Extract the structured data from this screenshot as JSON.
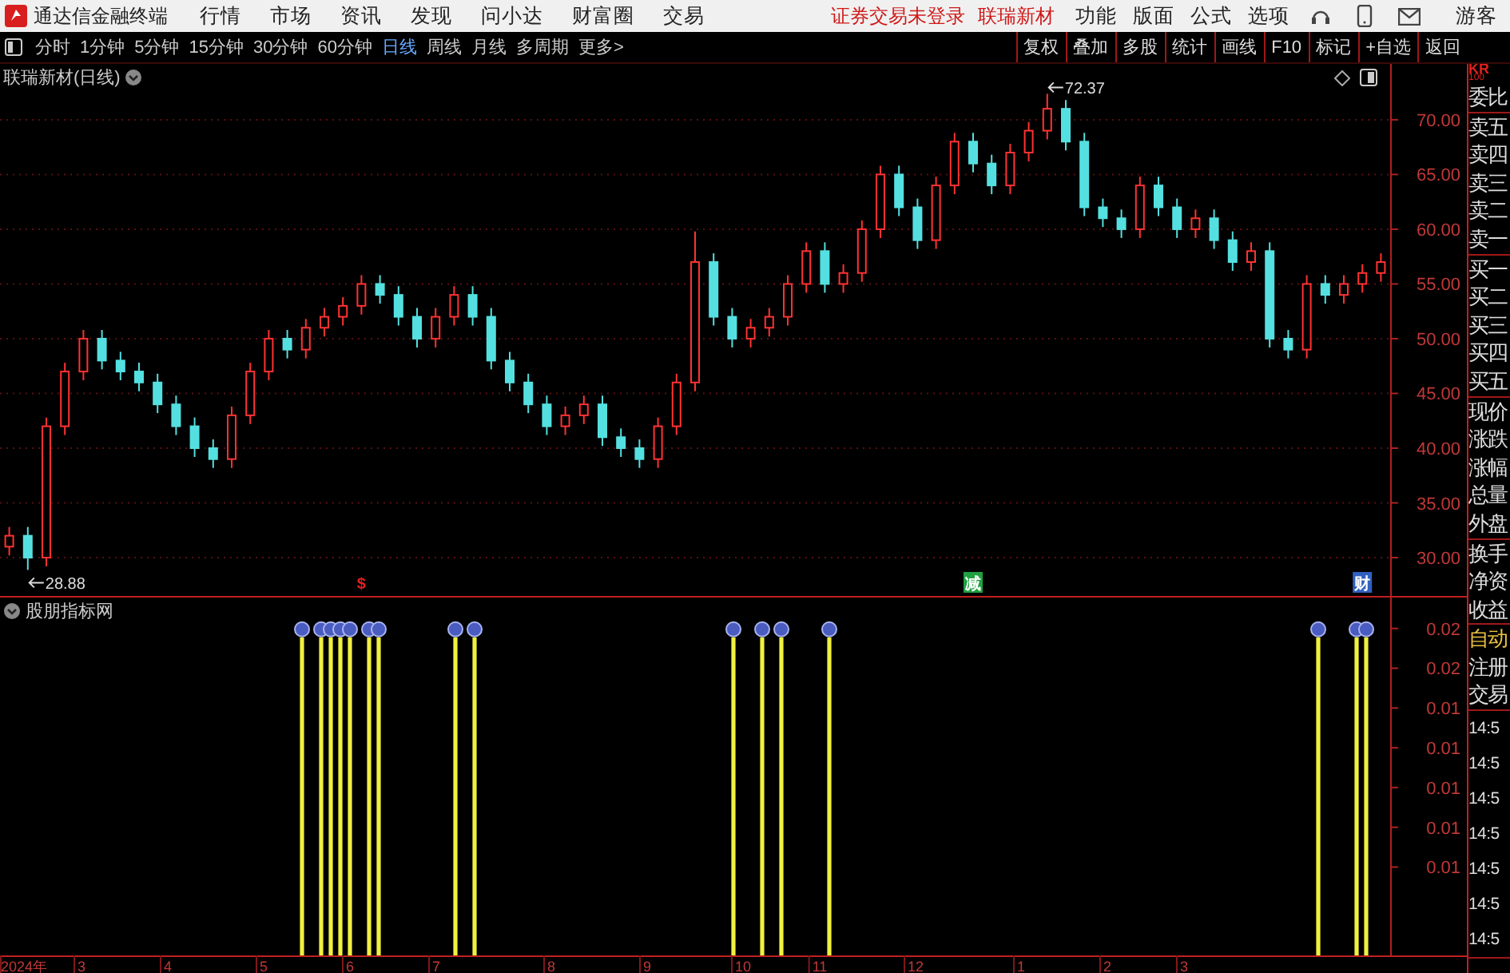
{
  "title_bar": {
    "app_title": "通达信金融终端",
    "menu": [
      "行情",
      "市场",
      "资讯",
      "发现",
      "问小达",
      "财富圈",
      "交易"
    ],
    "notices": [
      "证券交易未登录",
      "联瑞新材"
    ],
    "tools": [
      "功能",
      "版面",
      "公式",
      "选项"
    ],
    "user": "游客"
  },
  "toolbar": {
    "periods": [
      {
        "label": "分时",
        "selected": false
      },
      {
        "label": "1分钟",
        "selected": false
      },
      {
        "label": "5分钟",
        "selected": false
      },
      {
        "label": "15分钟",
        "selected": false
      },
      {
        "label": "30分钟",
        "selected": false
      },
      {
        "label": "60分钟",
        "selected": false
      },
      {
        "label": "日线",
        "selected": true
      },
      {
        "label": "周线",
        "selected": false
      },
      {
        "label": "月线",
        "selected": false
      },
      {
        "label": "多周期",
        "selected": false
      },
      {
        "label": "更多>",
        "selected": false
      }
    ],
    "buttons": [
      "复权",
      "叠加",
      "多股",
      "统计",
      "画线",
      "F10",
      "标记",
      "+自选",
      "返回"
    ]
  },
  "price_pane": {
    "title": "联瑞新材(日线)",
    "chart_data": {
      "type": "candlestick",
      "grid": true,
      "ylim": [
        26.5,
        75.1
      ],
      "categories": [
        null,
        null,
        null,
        null,
        null,
        null,
        null,
        null,
        null,
        null,
        null,
        null,
        null,
        null,
        null,
        null,
        null,
        null,
        null,
        null,
        null,
        null,
        null,
        null,
        null,
        null,
        null,
        null,
        null,
        null,
        null,
        null,
        null,
        null,
        null,
        null,
        null,
        null,
        null,
        null,
        null,
        null,
        null,
        null,
        null,
        null,
        null,
        null,
        null,
        null,
        null,
        null,
        null,
        null,
        null,
        null,
        null,
        null,
        null,
        null,
        null,
        null,
        null,
        null,
        null,
        null,
        null,
        null,
        null,
        null,
        null,
        null,
        null,
        null,
        null
      ],
      "yticks": [
        {
          "value": 30,
          "label": "30.00"
        },
        {
          "value": 35,
          "label": "35.00"
        },
        {
          "value": 40,
          "label": "40.00"
        },
        {
          "value": 45,
          "label": "45.00"
        },
        {
          "value": 50,
          "label": "50.00"
        },
        {
          "value": 55,
          "label": "55.00"
        },
        {
          "value": 60,
          "label": "60.00"
        },
        {
          "value": 65,
          "label": "65.00"
        },
        {
          "value": 70,
          "label": "70.00"
        }
      ],
      "ohlc": [
        [
          31,
          32.8,
          30.2,
          32
        ],
        [
          32,
          32.8,
          28.88,
          30
        ],
        [
          30,
          42.8,
          29.2,
          42
        ],
        [
          42,
          47.8,
          41.2,
          47
        ],
        [
          47,
          50.8,
          46.2,
          50
        ],
        [
          50,
          50.8,
          47.2,
          48
        ],
        [
          48,
          48.8,
          46.2,
          47
        ],
        [
          47,
          47.8,
          45.2,
          46
        ],
        [
          46,
          46.8,
          43.2,
          44
        ],
        [
          44,
          44.8,
          41.2,
          42
        ],
        [
          42,
          42.8,
          39.2,
          40
        ],
        [
          40,
          40.8,
          38.2,
          39
        ],
        [
          39,
          43.8,
          38.2,
          43
        ],
        [
          43,
          47.8,
          42.2,
          47
        ],
        [
          47,
          50.8,
          46.2,
          50
        ],
        [
          50,
          50.8,
          48.2,
          49
        ],
        [
          49,
          51.8,
          48.2,
          51
        ],
        [
          51,
          52.8,
          50.2,
          52
        ],
        [
          52,
          53.8,
          51.2,
          53
        ],
        [
          53,
          55.8,
          52.2,
          55
        ],
        [
          55,
          55.8,
          53.2,
          54
        ],
        [
          54,
          54.8,
          51.2,
          52
        ],
        [
          52,
          52.8,
          49.2,
          50
        ],
        [
          50,
          52.8,
          49.2,
          52
        ],
        [
          52,
          54.8,
          51.2,
          54
        ],
        [
          54,
          54.8,
          51.2,
          52
        ],
        [
          52,
          52.8,
          47.2,
          48
        ],
        [
          48,
          48.8,
          45.2,
          46
        ],
        [
          46,
          46.8,
          43.2,
          44
        ],
        [
          44,
          44.8,
          41.2,
          42
        ],
        [
          42,
          43.8,
          41.2,
          43
        ],
        [
          43,
          44.8,
          42.2,
          44
        ],
        [
          44,
          44.8,
          40.2,
          41
        ],
        [
          41,
          41.8,
          39.2,
          40
        ],
        [
          40,
          40.8,
          38.2,
          39
        ],
        [
          39,
          42.8,
          38.2,
          42
        ],
        [
          42,
          46.8,
          41.2,
          46
        ],
        [
          46,
          59.8,
          45.2,
          57
        ],
        [
          57,
          57.8,
          51.2,
          52
        ],
        [
          52,
          52.8,
          49.2,
          50
        ],
        [
          50,
          51.8,
          49.2,
          51
        ],
        [
          51,
          52.8,
          50.2,
          52
        ],
        [
          52,
          55.8,
          51.2,
          55
        ],
        [
          55,
          58.8,
          54.2,
          58
        ],
        [
          58,
          58.8,
          54.2,
          55
        ],
        [
          55,
          56.8,
          54.2,
          56
        ],
        [
          56,
          60.8,
          55.2,
          60
        ],
        [
          60,
          65.8,
          59.2,
          65
        ],
        [
          65,
          65.8,
          61.2,
          62
        ],
        [
          62,
          62.8,
          58.2,
          59
        ],
        [
          59,
          64.8,
          58.2,
          64
        ],
        [
          64,
          68.8,
          63.2,
          68
        ],
        [
          68,
          68.8,
          65.2,
          66
        ],
        [
          66,
          66.8,
          63.2,
          64
        ],
        [
          64,
          67.8,
          63.2,
          67
        ],
        [
          67,
          69.8,
          66.2,
          69
        ],
        [
          69,
          72.37,
          68.2,
          71
        ],
        [
          71,
          71.8,
          67.2,
          68
        ],
        [
          68,
          68.8,
          61.2,
          62
        ],
        [
          62,
          62.8,
          60.2,
          61
        ],
        [
          61,
          61.8,
          59.2,
          60
        ],
        [
          60,
          64.8,
          59.2,
          64
        ],
        [
          64,
          64.8,
          61.2,
          62
        ],
        [
          62,
          62.8,
          59.2,
          60
        ],
        [
          60,
          61.8,
          59.2,
          61
        ],
        [
          61,
          61.8,
          58.2,
          59
        ],
        [
          59,
          59.8,
          56.2,
          57
        ],
        [
          57,
          58.8,
          56.2,
          58
        ],
        [
          58,
          58.8,
          49.2,
          50
        ],
        [
          50,
          50.8,
          48.2,
          49
        ],
        [
          49,
          55.8,
          48.2,
          55
        ],
        [
          55,
          55.8,
          53.2,
          54
        ],
        [
          54,
          55.8,
          53.2,
          55
        ],
        [
          55,
          56.8,
          54.2,
          56
        ],
        [
          56,
          57.8,
          55.2,
          57
        ]
      ],
      "annotations": [
        "72.37",
        "28.88"
      ]
    },
    "events": [
      {
        "text": "$",
        "color": "#e02020"
      },
      {
        "text": "减",
        "color": "#20a040"
      },
      {
        "text": "财",
        "color": "#3060c0"
      }
    ]
  },
  "indicator_pane": {
    "title": "股朋指标网",
    "chart_data": {
      "type": "bar",
      "ylim": [
        0.0037,
        0.0199
      ],
      "categories": [
        null,
        null,
        "2024年",
        null,
        null,
        null,
        null,
        null,
        "3",
        null,
        null,
        null,
        null,
        null,
        null,
        null,
        null,
        "4",
        null,
        null,
        null,
        null,
        null,
        null,
        null,
        null,
        null,
        "5",
        null,
        null,
        null,
        null,
        null,
        null,
        null,
        null,
        "6",
        null,
        null,
        null,
        null,
        null,
        null,
        null,
        null,
        "7",
        null,
        null,
        null,
        null,
        null,
        null,
        null,
        null,
        null,
        null,
        null,
        "8",
        null,
        null,
        null,
        null,
        null,
        null,
        null,
        null,
        null,
        "9",
        null,
        null,
        null,
        null,
        null,
        null,
        null,
        null,
        null,
        "10",
        null,
        null,
        null,
        null,
        null,
        null,
        null,
        "11",
        null,
        null,
        null,
        null,
        null,
        null,
        null,
        null,
        null,
        "12",
        null,
        null,
        null,
        null,
        null,
        null,
        null,
        null,
        null,
        null,
        "1",
        null,
        null,
        null,
        null,
        null,
        null,
        null,
        null,
        "2",
        null,
        null,
        null,
        null,
        null,
        null,
        null,
        "3",
        null,
        null,
        null,
        null,
        null,
        null,
        null,
        null,
        null,
        null,
        null,
        null,
        null,
        null,
        null,
        null,
        null,
        null,
        null,
        null,
        null
      ],
      "values": [
        null,
        null,
        null,
        null,
        null,
        null,
        null,
        null,
        null,
        null,
        null,
        null,
        null,
        null,
        null,
        null,
        null,
        null,
        null,
        null,
        null,
        null,
        null,
        null,
        null,
        null,
        null,
        null,
        null,
        null,
        null,
        0.0181,
        null,
        0.0181,
        0.0181,
        0.0181,
        0.0181,
        null,
        0.0181,
        0.0181,
        null,
        null,
        null,
        null,
        null,
        null,
        null,
        0.0181,
        null,
        0.0181,
        null,
        null,
        null,
        null,
        null,
        null,
        null,
        null,
        null,
        null,
        null,
        null,
        null,
        null,
        null,
        null,
        null,
        null,
        null,
        null,
        null,
        null,
        null,
        null,
        null,
        null,
        0.0181,
        null,
        null,
        0.0181,
        null,
        0.0181,
        null,
        null,
        null,
        null,
        0.0181,
        null,
        null,
        null,
        null,
        null,
        null,
        null,
        null,
        null,
        null,
        null,
        null,
        null,
        null,
        null,
        null,
        null,
        null,
        null,
        null,
        null,
        null,
        null,
        null,
        null,
        null,
        null,
        null,
        null,
        null,
        null,
        null,
        null,
        null,
        null,
        null,
        null,
        null,
        null,
        null,
        null,
        null,
        null,
        null,
        null,
        null,
        null,
        null,
        null,
        null,
        0.0181,
        null,
        null,
        null,
        0.0181,
        0.0181,
        null,
        null
      ],
      "yticks": [
        {
          "value": 0.0185,
          "label": "0.02"
        },
        {
          "value": 0.0167,
          "label": "0.02"
        },
        {
          "value": 0.0149,
          "label": "0.01"
        },
        {
          "value": 0.0131,
          "label": "0.01"
        },
        {
          "value": 0.0113,
          "label": "0.01"
        },
        {
          "value": 0.0095,
          "label": "0.01"
        },
        {
          "value": 0.0077,
          "label": "0.01"
        }
      ],
      "grid": false
    }
  },
  "side_panel": {
    "header": [
      "KR",
      "100"
    ],
    "groups": [
      {
        "items": [
          {
            "label": "委比",
            "kind": "plain"
          }
        ]
      },
      {
        "items": [
          {
            "label": "卖五",
            "kind": "plain"
          },
          {
            "label": "卖四",
            "kind": "plain"
          },
          {
            "label": "卖三",
            "kind": "plain"
          },
          {
            "label": "卖二",
            "kind": "plain"
          },
          {
            "label": "卖一",
            "kind": "plain"
          }
        ]
      },
      {
        "items": [
          {
            "label": "买一",
            "kind": "plain"
          },
          {
            "label": "买二",
            "kind": "plain"
          },
          {
            "label": "买三",
            "kind": "plain"
          },
          {
            "label": "买四",
            "kind": "plain"
          },
          {
            "label": "买五",
            "kind": "plain"
          }
        ]
      },
      {
        "items": [
          {
            "label": "现价",
            "kind": "plain"
          },
          {
            "label": "涨跌",
            "kind": "plain"
          },
          {
            "label": "涨幅",
            "kind": "plain"
          },
          {
            "label": "总量",
            "kind": "plain"
          },
          {
            "label": "外盘",
            "kind": "plain"
          }
        ]
      },
      {
        "items": [
          {
            "label": "换手",
            "kind": "plain"
          },
          {
            "label": "净资",
            "kind": "plain"
          },
          {
            "label": "收益",
            "kind": "plain"
          }
        ]
      },
      {
        "items": [
          {
            "label": "自动",
            "kind": "highlight"
          },
          {
            "label": "注册",
            "kind": "plain"
          },
          {
            "label": "交易",
            "kind": "plain"
          }
        ]
      },
      {
        "items": [
          {
            "label": "14:5",
            "kind": "time"
          },
          {
            "label": "14:5",
            "kind": "time"
          },
          {
            "label": "14:5",
            "kind": "time"
          },
          {
            "label": "14:5",
            "kind": "time"
          },
          {
            "label": "14:5",
            "kind": "time"
          },
          {
            "label": "14:5",
            "kind": "time"
          },
          {
            "label": "14:5",
            "kind": "time"
          }
        ]
      }
    ]
  }
}
